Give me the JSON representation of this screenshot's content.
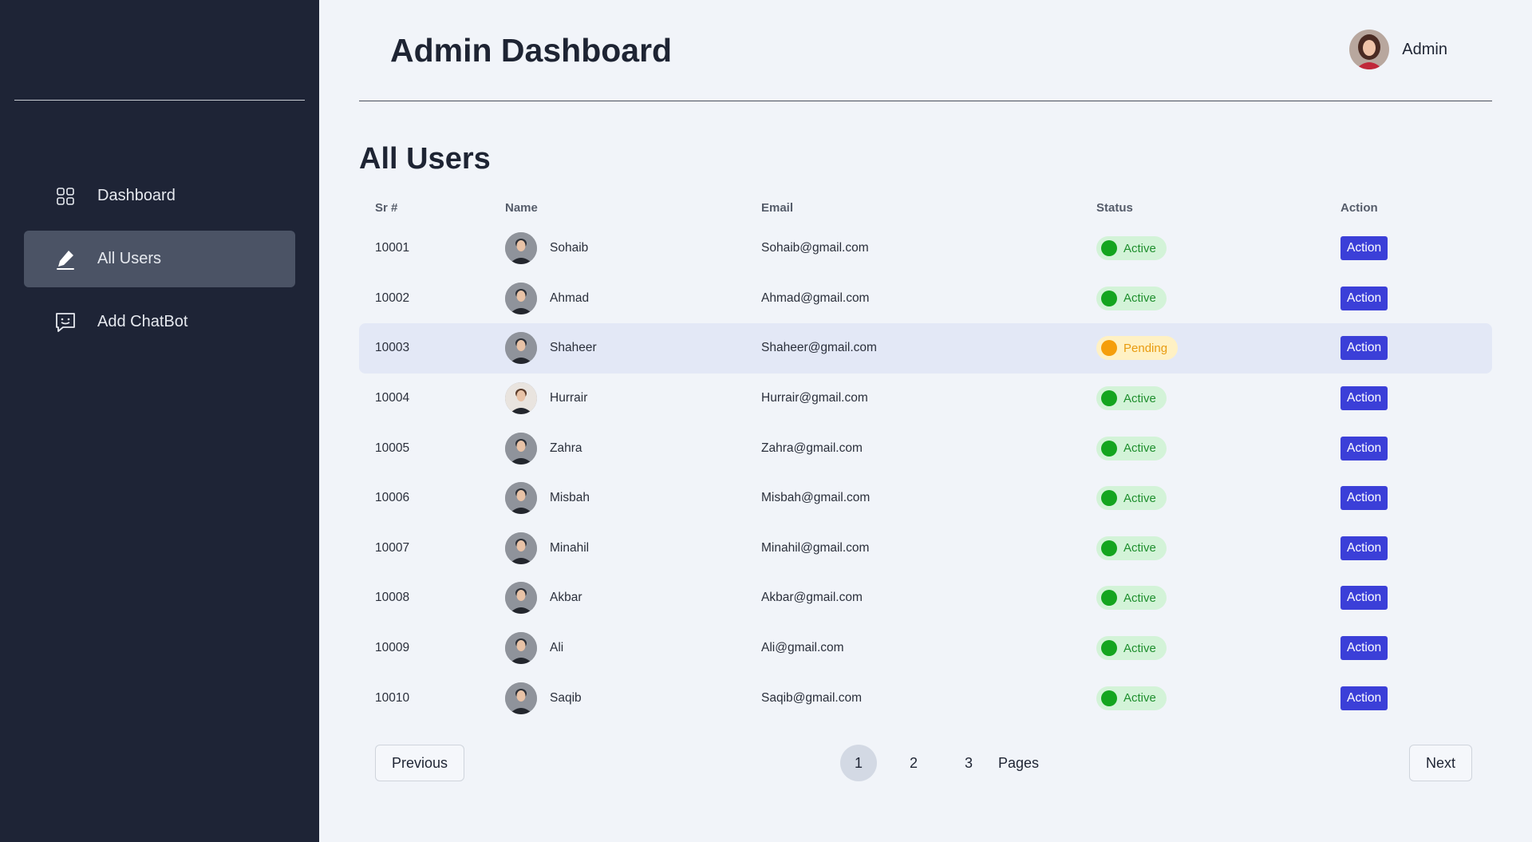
{
  "sidebar": {
    "items": [
      {
        "label": "Dashboard",
        "icon": "grid-icon"
      },
      {
        "label": "All Users",
        "icon": "pencil-icon",
        "active": true
      },
      {
        "label": "Add ChatBot",
        "icon": "chat-icon"
      }
    ]
  },
  "header": {
    "title": "Admin Dashboard",
    "user_name": "Admin"
  },
  "main": {
    "section_title": "All Users",
    "columns": [
      "Sr #",
      "Name",
      "Email",
      "Status",
      "Action"
    ],
    "rows": [
      {
        "sr": "10001",
        "name": "Sohaib",
        "email": "Sohaib@gmail.com",
        "status": "Active",
        "action": "Action"
      },
      {
        "sr": "10002",
        "name": "Ahmad",
        "email": "Ahmad@gmail.com",
        "status": "Active",
        "action": "Action"
      },
      {
        "sr": "10003",
        "name": "Shaheer",
        "email": "Shaheer@gmail.com",
        "status": "Pending",
        "action": "Action"
      },
      {
        "sr": "10004",
        "name": "Hurrair",
        "email": "Hurrair@gmail.com",
        "status": "Active",
        "action": "Action"
      },
      {
        "sr": "10005",
        "name": "Zahra",
        "email": "Zahra@gmail.com",
        "status": "Active",
        "action": "Action"
      },
      {
        "sr": "10006",
        "name": "Misbah",
        "email": "Misbah@gmail.com",
        "status": "Active",
        "action": "Action"
      },
      {
        "sr": "10007",
        "name": "Minahil",
        "email": "Minahil@gmail.com",
        "status": "Active",
        "action": "Action"
      },
      {
        "sr": "10008",
        "name": "Akbar",
        "email": "Akbar@gmail.com",
        "status": "Active",
        "action": "Action"
      },
      {
        "sr": "10009",
        "name": "Ali",
        "email": "Ali@gmail.com",
        "status": "Active",
        "action": "Action"
      },
      {
        "sr": "10010",
        "name": "Saqib",
        "email": "Saqib@gmail.com",
        "status": "Active",
        "action": "Action"
      }
    ]
  },
  "pagination": {
    "previous": "Previous",
    "next": "Next",
    "pages": [
      "1",
      "2",
      "3"
    ],
    "current": "1",
    "pages_label": "Pages"
  },
  "colors": {
    "sidebar_bg": "#1e2436",
    "active_nav": "#4b5365",
    "action_button": "#3b3fd8",
    "active_badge": "#d3f3d8",
    "pending_badge": "#fff1c4"
  }
}
